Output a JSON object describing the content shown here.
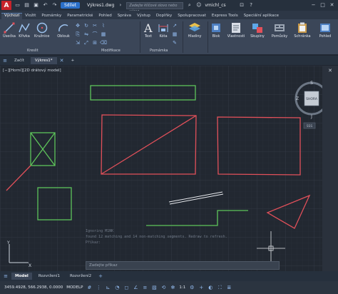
{
  "titlebar": {
    "app_logo": "A",
    "share_label": "Sdílet",
    "doc_title": "Výkres1.dwg",
    "search_placeholder": "Zadejte klíčové slovo nebo výraz",
    "user": "vmichl_cs"
  },
  "ribbon_tabs": [
    "Výchozí",
    "Vložit",
    "Poznámky",
    "Parametrické",
    "Pohled",
    "Správa",
    "Výstup",
    "Doplňky",
    "Spolupracovat",
    "Express Tools",
    "Speciální aplikace"
  ],
  "ribbon_tools": {
    "line": "Úsečka",
    "polyline": "Křivka",
    "circle": "Kružnice",
    "arc": "Oblouk",
    "text": "Text",
    "dimension": "Kóta",
    "layers": "Hladiny",
    "block": "Blok",
    "properties": "Vlastnosti",
    "groups": "Skupiny",
    "utilities": "Pomůcky",
    "clipboard": "Schránka",
    "view": "Pohled"
  },
  "ribbon_panels": {
    "draw": "Kreslit",
    "modify": "Modifikace",
    "annotation": "Poznámka"
  },
  "file_tabs": {
    "start": "Začít",
    "drawing": "Výkres1*",
    "add": "+"
  },
  "viewport": {
    "label": "[−][Horní][2D drátový model]"
  },
  "viewcube": {
    "north": "S",
    "south": "J",
    "east": "V",
    "west": "Z",
    "face": "SHORA",
    "ucs": "SSS"
  },
  "command": {
    "history": [
      "Ignoring M1NK",
      "found 12 matching and 14 non-matching segments. Redraw to refresh.",
      "Příkaz:"
    ],
    "prompt": "Zadejte příkaz"
  },
  "layout_tabs": [
    "Model",
    "Rozvržení1",
    "Rozvržení2"
  ],
  "statusbar": {
    "coords": "3459.4928, 566.2938, 0.0000",
    "mode": "MODELP",
    "scale": "1:1"
  },
  "colors": {
    "red": "#e2505a",
    "green": "#5ec45a",
    "white": "#e8eaee",
    "canvas": "#222831"
  }
}
